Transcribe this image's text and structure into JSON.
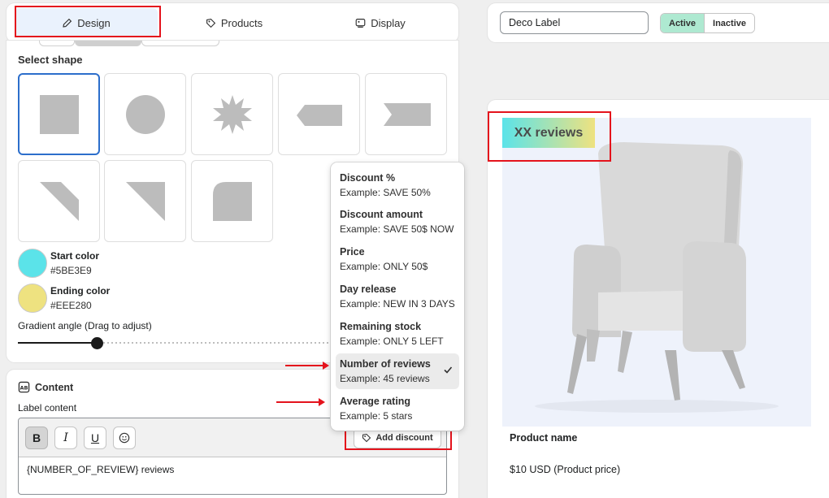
{
  "tabs": [
    {
      "label": "Design",
      "icon": "pencil-icon"
    },
    {
      "label": "Products",
      "icon": "tag-icon"
    },
    {
      "label": "Display",
      "icon": "display-icon"
    }
  ],
  "design": {
    "select_shape_heading": "Select shape",
    "shapes": [
      "square",
      "circle",
      "starburst",
      "tag-left",
      "ribbon-right",
      "corner-triangle-left",
      "corner-triangle-right",
      "rounded-leaf"
    ],
    "selected_shape": "square",
    "start_color": {
      "label": "Start color",
      "value": "#5BE3E9"
    },
    "ending_color": {
      "label": "Ending color",
      "value": "#EEE280"
    },
    "gradient_label": "Gradient angle (Drag to adjust)"
  },
  "content": {
    "heading": "Content",
    "label_content": "Label content",
    "toolbar": {
      "bold": "B",
      "italic": "I",
      "underline": "U",
      "add_discount": "Add discount"
    },
    "editor_text": "{NUMBER_OF_REVIEW} reviews"
  },
  "dropdown": {
    "items": [
      {
        "title": "Discount %",
        "example": "Example: SAVE 50%"
      },
      {
        "title": "Discount amount",
        "example": "Example: SAVE 50$ NOW"
      },
      {
        "title": "Price",
        "example": "Example: ONLY 50$"
      },
      {
        "title": "Day release",
        "example": "Example: NEW IN 3 DAYS"
      },
      {
        "title": "Remaining stock",
        "example": "Example: ONLY 5 LEFT"
      },
      {
        "title": "Number of reviews",
        "example": "Example: 45 reviews"
      },
      {
        "title": "Average rating",
        "example": "Example: 5 stars"
      }
    ],
    "selected": "Number of reviews"
  },
  "label_settings": {
    "name_value": "Deco Label",
    "status_active": "Active",
    "status_inactive": "Inactive",
    "status": "Active"
  },
  "preview": {
    "badge_text": "XX reviews",
    "product_name": "Product name",
    "product_price": "$10 USD (Product price)"
  },
  "colors": {
    "accent": "#2c6ecb",
    "annotation": "#e4131c",
    "active_badge": "#aee9d1"
  }
}
